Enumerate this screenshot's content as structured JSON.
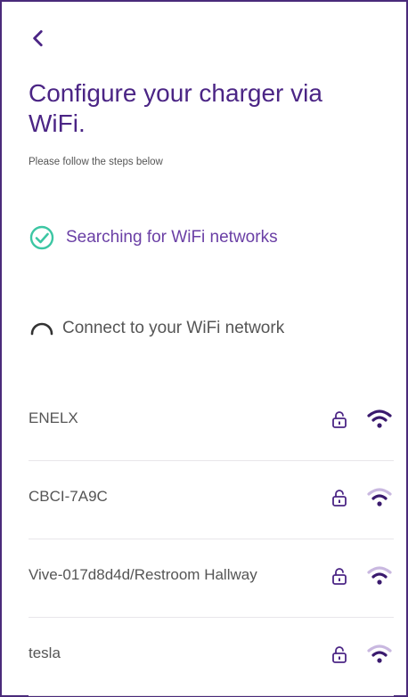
{
  "header": {
    "title": "Configure your charger via WiFi.",
    "subtitle": "Please follow the steps below"
  },
  "steps": [
    {
      "label": "Searching for WiFi networks",
      "state": "complete"
    },
    {
      "label": "Connect to your WiFi network",
      "state": "in-progress"
    }
  ],
  "networks": [
    {
      "name": "ENELX",
      "secured": true,
      "signal": "strong"
    },
    {
      "name": "CBCI-7A9C",
      "secured": true,
      "signal": "medium"
    },
    {
      "name": "Vive-017d8d4d/Restroom Hallway",
      "secured": true,
      "signal": "medium"
    },
    {
      "name": "tesla",
      "secured": true,
      "signal": "medium"
    }
  ],
  "colors": {
    "primary": "#4b2585",
    "accent_check": "#3cc6a3",
    "text_muted": "#555555",
    "divider": "#e8e6ea"
  },
  "icons": {
    "back": "chevron-left-icon",
    "step_complete": "check-circle-icon",
    "step_progress": "spinner-icon",
    "lock": "lock-icon",
    "wifi": "wifi-icon"
  }
}
